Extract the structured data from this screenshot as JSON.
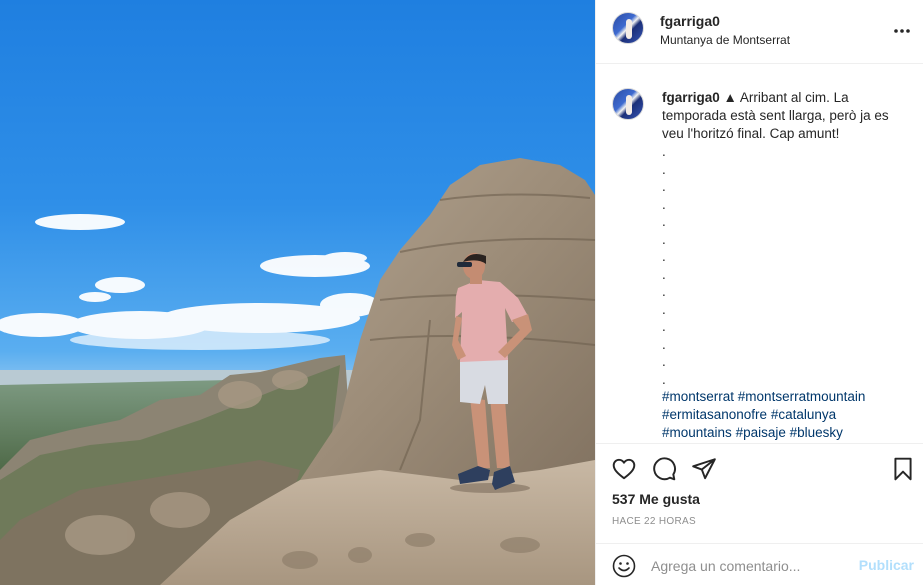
{
  "post": {
    "username": "fgarriga0",
    "location": "Muntanya de Montserrat",
    "image_alt": "Man in pink t-shirt and sunglasses standing on top of a rock at Montserrat mountain under blue sky",
    "caption": {
      "username": "fgarriga0",
      "text": " ▲ Arribant al cim. La temporada està sent llarga, però ja es veu l'horitzó final. Cap amunt!",
      "dots": [
        ".",
        ".",
        ".",
        ".",
        ".",
        ".",
        ".",
        ".",
        ".",
        ".",
        ".",
        ".",
        ".",
        "."
      ],
      "hashtags_line1": [
        "#montserrat",
        "#montserratmountain"
      ],
      "hashtags_line2": [
        "#ermitasanonofre",
        "#catalunya"
      ],
      "hashtags_line3": [
        "#mountains",
        "#paisaje",
        "#bluesky"
      ]
    },
    "likes": "537 Me gusta",
    "time": "HACE 22 HORAS",
    "comment": {
      "placeholder": "Agrega un comentario...",
      "publish_label": "Publicar"
    }
  },
  "icons": {
    "more": "more-horizontal-icon",
    "like": "heart-icon",
    "comment": "comment-bubble-icon",
    "share": "paper-plane-icon",
    "save": "bookmark-icon",
    "emoji": "smiley-icon"
  },
  "colors": {
    "text": "#262626",
    "muted": "#8e8e8e",
    "hashtag": "#00376b",
    "publish_disabled": "#b2dffc",
    "border": "#efefef"
  }
}
